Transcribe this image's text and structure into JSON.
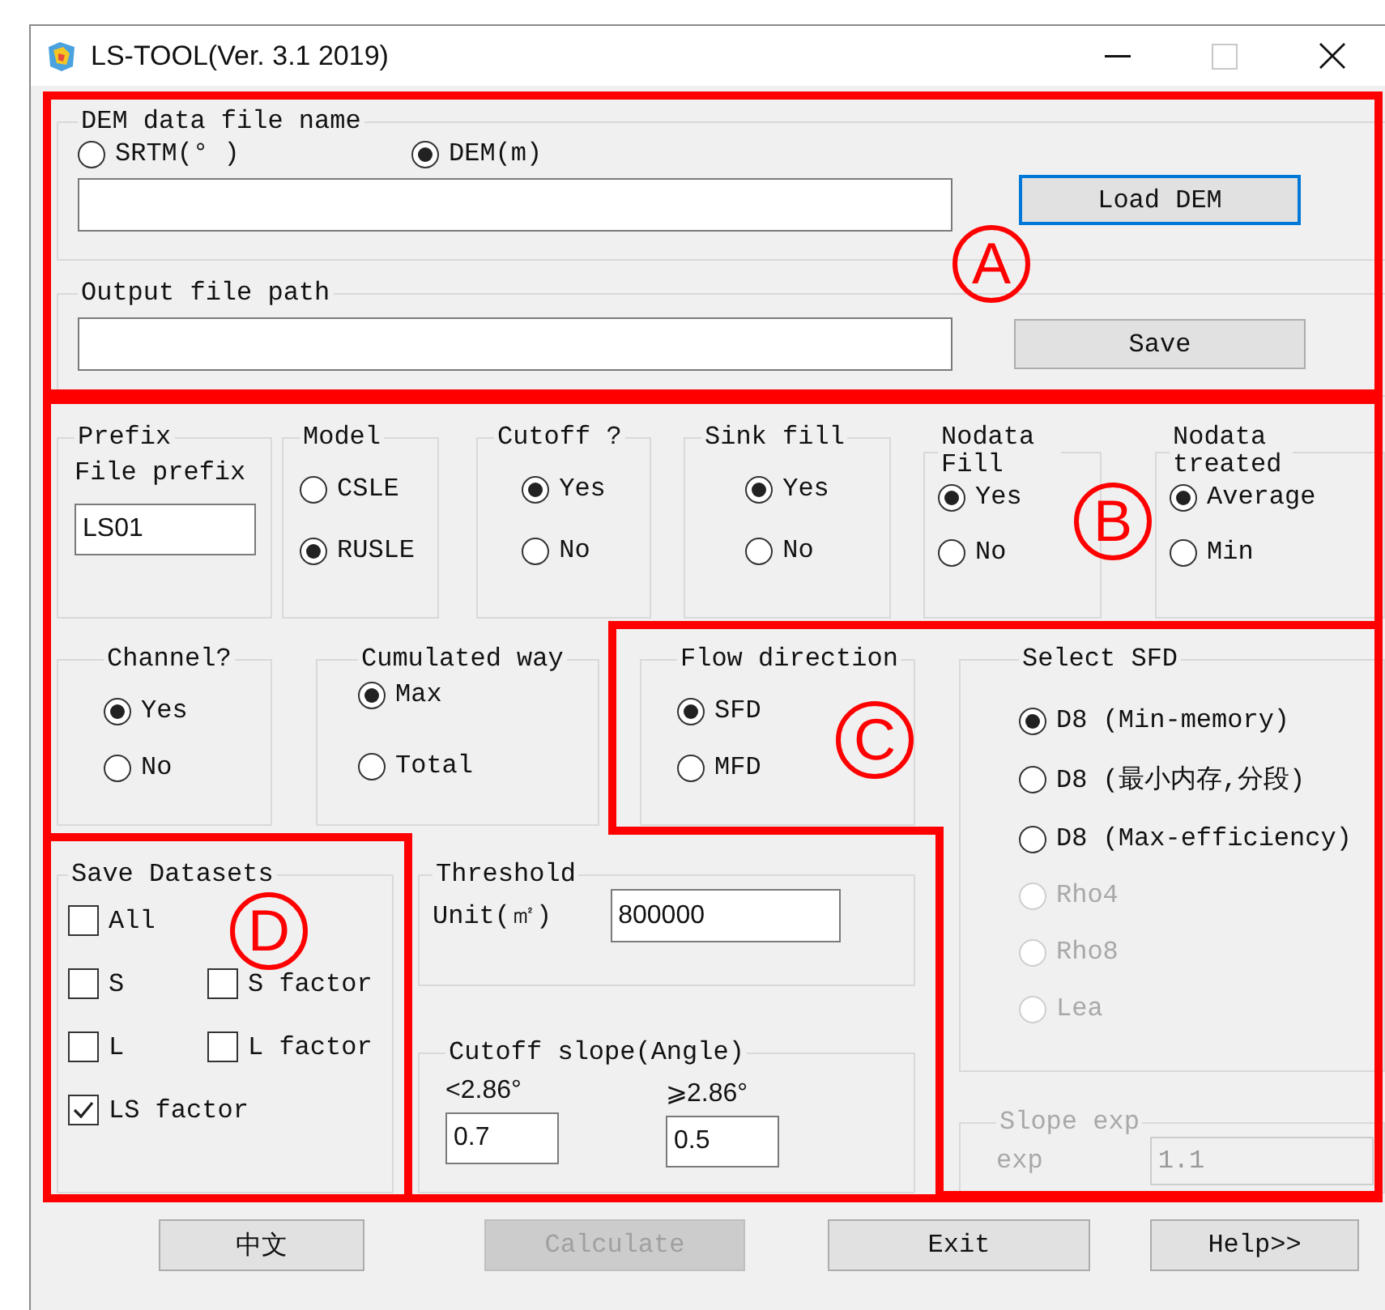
{
  "window": {
    "title": "LS-TOOL(Ver. 3.1 2019)"
  },
  "dem_file": {
    "label": "DEM data file name",
    "options": [
      {
        "label": "SRTM(° )",
        "selected": false
      },
      {
        "label": "DEM(m)",
        "selected": true
      }
    ],
    "button": {
      "label": "Load DEM",
      "focused": true
    }
  },
  "output_file": {
    "label": "Output file path",
    "button": {
      "label": "Save",
      "focused": false
    }
  },
  "prefix": {
    "label": "Prefix",
    "field_label": "File prefix",
    "value": "LS01"
  },
  "option_groups": [
    {
      "label": "Model",
      "options": [
        {
          "label": "CSLE",
          "selected": false
        },
        {
          "label": "RUSLE",
          "selected": true
        }
      ]
    },
    {
      "label": "Cutoff ?",
      "options": [
        {
          "label": "Yes",
          "selected": true
        },
        {
          "label": "No",
          "selected": false
        }
      ]
    },
    {
      "label": "Sink fill",
      "options": [
        {
          "label": "Yes",
          "selected": true
        },
        {
          "label": "No",
          "selected": false
        }
      ]
    },
    {
      "label": "Nodata Fill",
      "options": [
        {
          "label": "Yes",
          "selected": true
        },
        {
          "label": "No",
          "selected": false
        }
      ]
    },
    {
      "label": "Nodata treated",
      "options": [
        {
          "label": "Average",
          "selected": true
        },
        {
          "label": "Min",
          "selected": false
        }
      ]
    }
  ],
  "lower_groups": [
    {
      "label": "Channel?",
      "options": [
        {
          "label": "Yes",
          "selected": true
        },
        {
          "label": "No",
          "selected": false
        }
      ]
    },
    {
      "label": "Cumulated way",
      "options": [
        {
          "label": "Max",
          "selected": true
        },
        {
          "label": "Total",
          "selected": false
        }
      ]
    },
    {
      "label": "Flow direction",
      "options": [
        {
          "label": "SFD",
          "selected": true
        },
        {
          "label": "MFD",
          "selected": false
        }
      ]
    }
  ],
  "select_sfd": {
    "label": "Select SFD",
    "options": [
      {
        "label": "D8 (Min-memory)",
        "selected": true,
        "disabled": false
      },
      {
        "label": "D8 (最小内存,分段)",
        "selected": false,
        "disabled": false
      },
      {
        "label": "D8 (Max-efficiency)",
        "selected": false,
        "disabled": false
      },
      {
        "label": "Rho4",
        "selected": false,
        "disabled": true
      },
      {
        "label": "Rho8",
        "selected": false,
        "disabled": true
      },
      {
        "label": "Lea",
        "selected": false,
        "disabled": true
      }
    ]
  },
  "save_datasets": {
    "label": "Save Datasets",
    "rows": [
      [
        {
          "label": "All",
          "checked": false
        }
      ],
      [
        {
          "label": "S",
          "checked": false
        },
        {
          "label": "S factor",
          "checked": false
        }
      ],
      [
        {
          "label": "L",
          "checked": false
        },
        {
          "label": "L factor",
          "checked": false
        }
      ],
      [
        {
          "label": "LS factor",
          "checked": true
        }
      ]
    ]
  },
  "threshold": {
    "label": "Threshold",
    "field_label": "Unit(㎡)",
    "value": "800000"
  },
  "cutoff_slope": {
    "label": "Cutoff slope(Angle)",
    "fields": [
      {
        "label": "<2.86°",
        "value": "0.7"
      },
      {
        "label": "⩾2.86°",
        "value": "0.5"
      }
    ]
  },
  "slope_exp": {
    "label": "Slope exp",
    "disabled": true,
    "field_label": "exp",
    "value": "1.1"
  },
  "buttons": [
    {
      "label": "中文",
      "disabled": false
    },
    {
      "label": "Calculate",
      "disabled": true
    },
    {
      "label": "Exit",
      "disabled": false
    },
    {
      "label": "Help>>",
      "disabled": false
    }
  ],
  "annotations": [
    {
      "label": "A"
    },
    {
      "label": "B"
    },
    {
      "label": "C"
    },
    {
      "label": "D"
    }
  ]
}
